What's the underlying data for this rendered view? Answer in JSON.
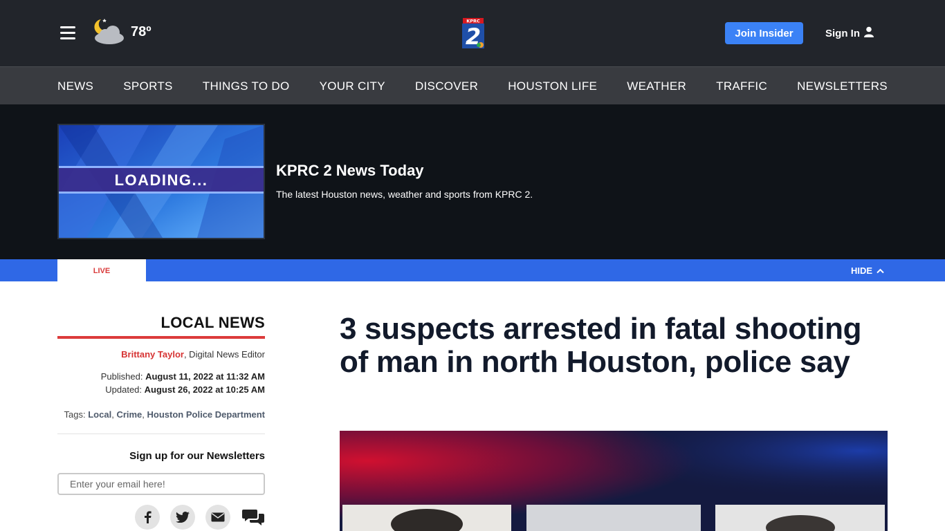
{
  "header": {
    "menu_icon": "hamburger-menu-icon",
    "weather_icon": "moon-cloud-icon",
    "temperature": "78º",
    "logo_icon": "kprc-2-logo",
    "join_insider_label": "Join Insider",
    "sign_in_label": "Sign In",
    "user_icon": "user-icon"
  },
  "nav": {
    "items": [
      {
        "label": "NEWS"
      },
      {
        "label": "SPORTS"
      },
      {
        "label": "THINGS TO DO"
      },
      {
        "label": "YOUR CITY"
      },
      {
        "label": "DISCOVER"
      },
      {
        "label": "HOUSTON LIFE"
      },
      {
        "label": "WEATHER"
      },
      {
        "label": "TRAFFIC"
      },
      {
        "label": "NEWSLETTERS"
      }
    ]
  },
  "video": {
    "thumbnail_text": "LOADING...",
    "title": "KPRC 2 News Today",
    "description": "The latest Houston news, weather and sports from KPRC 2."
  },
  "livebar": {
    "live_label": "LIVE",
    "hide_label": "HIDE"
  },
  "sidebar": {
    "section_title": "LOCAL NEWS",
    "author": "Brittany Taylor",
    "author_role": ", Digital News Editor",
    "published_label": "Published: ",
    "published_value": "August 11, 2022 at 11:32 AM",
    "updated_label": "Updated: ",
    "updated_value": "August 26, 2022 at 10:25 AM",
    "tags_label": "Tags: ",
    "tags": [
      "Local",
      "Crime",
      "Houston Police Department"
    ],
    "newsletter_title": "Sign up for our Newsletters",
    "email_placeholder": "Enter your email here!",
    "social_icons": [
      "facebook-icon",
      "twitter-icon",
      "email-icon",
      "comments-icon"
    ]
  },
  "article": {
    "headline": "3 suspects arrested in fatal shooting of man in north Houston, police say"
  },
  "colors": {
    "header_bg": "#22252b",
    "nav_bg": "#393b40",
    "video_bg": "#0f1318",
    "accent_blue": "#2f68e6",
    "insider_blue": "#3b82f6",
    "live_red": "#d93a3a",
    "headline": "#121a2b"
  }
}
